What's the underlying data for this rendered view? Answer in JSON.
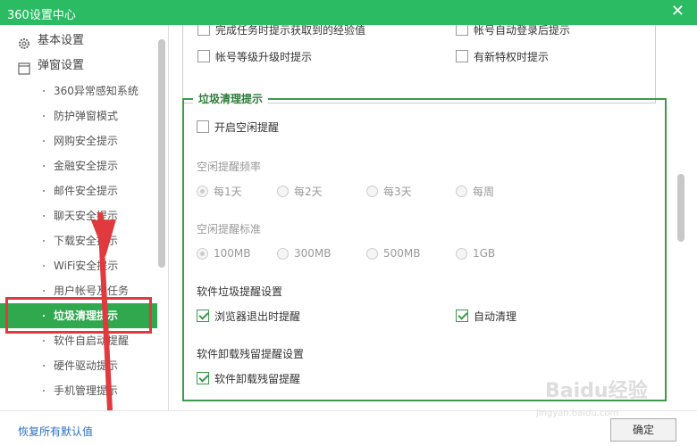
{
  "window": {
    "title": "360设置中心",
    "close_glyph": "✕"
  },
  "sidebar": {
    "categories": [
      {
        "label": "基本设置",
        "icon": "gear-icon"
      },
      {
        "label": "弹窗设置",
        "icon": "window-icon"
      }
    ],
    "items": [
      {
        "label": "360异常感知系统"
      },
      {
        "label": "防护弹窗模式"
      },
      {
        "label": "网购安全提示"
      },
      {
        "label": "金融安全提示"
      },
      {
        "label": "邮件安全提示"
      },
      {
        "label": "聊天安全提示"
      },
      {
        "label": "下载安全提示"
      },
      {
        "label": "WiFi安全提示"
      },
      {
        "label": "用户帐号及任务"
      },
      {
        "label": "垃圾清理提示",
        "active": true
      },
      {
        "label": "软件自启动提醒"
      },
      {
        "label": "硬件驱动提示"
      },
      {
        "label": "手机管理提示"
      }
    ]
  },
  "previous_section": {
    "rows": [
      {
        "label": "完成任务时提示获取到的经验值",
        "checked": false
      },
      {
        "label": "帐号自动登录后提示",
        "checked": false
      },
      {
        "label": "帐号等级升级时提示",
        "checked": false
      },
      {
        "label": "有新特权时提示",
        "checked": false
      }
    ]
  },
  "cleanup": {
    "legend": "垃圾清理提示",
    "idle_reminder": {
      "label": "开启空闲提醒",
      "checked": false
    },
    "frequency": {
      "label": "空闲提醒频率",
      "options": [
        "每1天",
        "每2天",
        "每3天",
        "每周"
      ],
      "selected": "每1天"
    },
    "threshold": {
      "label": "空闲提醒标准",
      "options": [
        "100MB",
        "300MB",
        "500MB",
        "1GB"
      ],
      "selected": "100MB"
    },
    "software_junk": {
      "label": "软件垃圾提醒设置",
      "options": [
        {
          "label": "浏览器退出时提醒",
          "checked": true
        },
        {
          "label": "自动清理",
          "checked": true
        }
      ]
    },
    "uninstall_residue": {
      "label": "软件卸载残留提醒设置",
      "options": [
        {
          "label": "软件卸载残留提醒",
          "checked": true
        }
      ]
    }
  },
  "footer": {
    "restore_label": "恢复所有默认值",
    "ok_label": "确定"
  },
  "watermark": {
    "text": "Baidu经验",
    "sub": "jingyan.baidu.com"
  },
  "colors": {
    "accent": "#2bbb63",
    "active_item": "#2fa84e",
    "group_border": "#3c9b4c",
    "annotation": "#e0393e"
  }
}
